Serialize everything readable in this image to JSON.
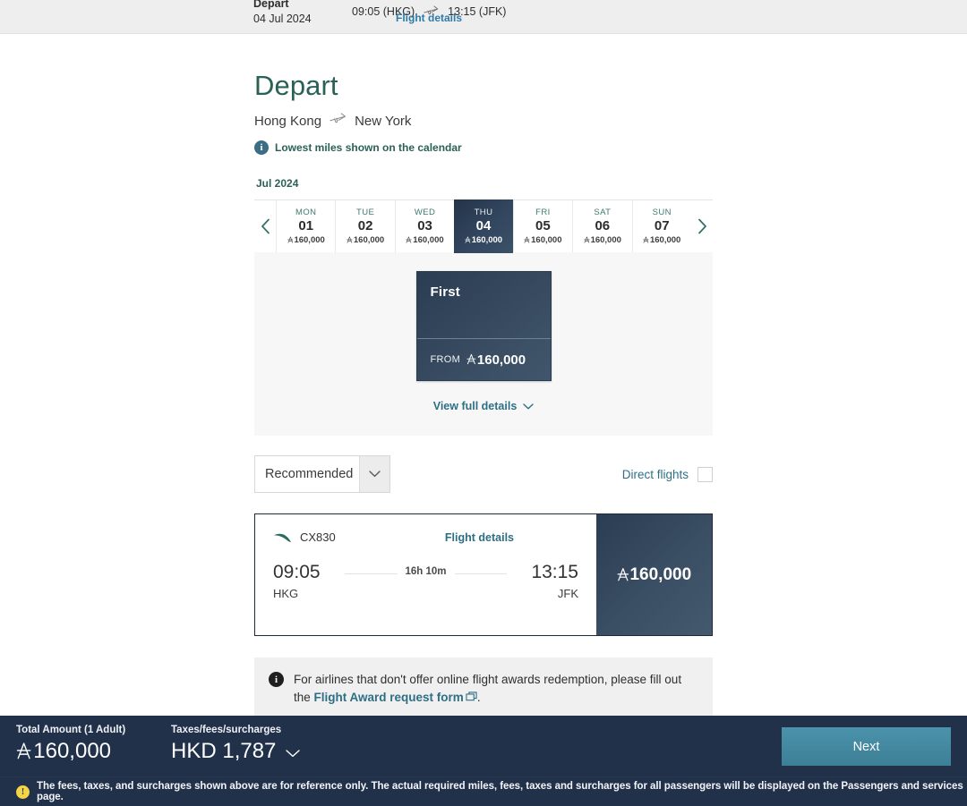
{
  "topbar": {
    "label": "Depart",
    "date": "04 Jul 2024",
    "depart_time": "09:05 (HKG)",
    "arrive_time": "13:15 (JFK)",
    "plane_icon": "airplane-icon",
    "details_link": "Flight details"
  },
  "header": {
    "title": "Depart",
    "origin": "Hong Kong",
    "destination": "New York",
    "plane_icon": "airplane-icon",
    "info_icon": "info-icon",
    "notice": "Lowest miles shown on the calendar"
  },
  "calendar": {
    "month": "Jul 2024",
    "prev_icon": "chevron-left-icon",
    "next_icon": "chevron-right-icon",
    "miles_symbol": "asia-miles-icon",
    "days": [
      {
        "dow": "MON",
        "date": "01",
        "miles": "160,000",
        "selected": false
      },
      {
        "dow": "TUE",
        "date": "02",
        "miles": "160,000",
        "selected": false
      },
      {
        "dow": "WED",
        "date": "03",
        "miles": "160,000",
        "selected": false
      },
      {
        "dow": "THU",
        "date": "04",
        "miles": "160,000",
        "selected": true
      },
      {
        "dow": "FRI",
        "date": "05",
        "miles": "160,000",
        "selected": false
      },
      {
        "dow": "SAT",
        "date": "06",
        "miles": "160,000",
        "selected": false
      },
      {
        "dow": "SUN",
        "date": "07",
        "miles": "160,000",
        "selected": false
      }
    ]
  },
  "cabin": {
    "name": "First",
    "from_label": "FROM",
    "price": "160,000",
    "view_details": "View full details",
    "chevron_icon": "chevron-down-icon"
  },
  "filters": {
    "sort_value": "Recommended",
    "sort_caret_icon": "chevron-down-icon",
    "direct_label": "Direct flights",
    "direct_checked": false
  },
  "flight": {
    "airline_logo": "cathay-brushwing-icon",
    "flight_number": "CX830",
    "details_link": "Flight details",
    "depart_time": "09:05",
    "depart_code": "HKG",
    "duration": "16h 10m",
    "arrive_time": "13:15",
    "arrive_code": "JFK",
    "price": "160,000"
  },
  "infobox": {
    "icon": "info-icon",
    "text_before": "For airlines that don't offer online flight awards redemption, please fill out the ",
    "link_text": "Flight Award request form",
    "external_icon": "external-link-icon",
    "text_after": "."
  },
  "bottombar": {
    "total_label": "Total Amount (1 Adult)",
    "total_value": "160,000",
    "tax_label": "Taxes/fees/surcharges",
    "tax_value": "HKD 1,787",
    "tax_caret_icon": "chevron-down-icon",
    "next_label": "Next"
  },
  "disclaimer": {
    "icon": "warning-icon",
    "text": "The fees, taxes, and surcharges shown above are for reference only. The actual required miles, fees, taxes and surcharges for all passengers will be displayed on the Passengers and services page."
  },
  "colors": {
    "brand_green": "#2a6157",
    "link_blue": "#2e6f86",
    "navy": "#22314a",
    "next_button": "#3d7f96",
    "warning_yellow": "#f5d547"
  }
}
